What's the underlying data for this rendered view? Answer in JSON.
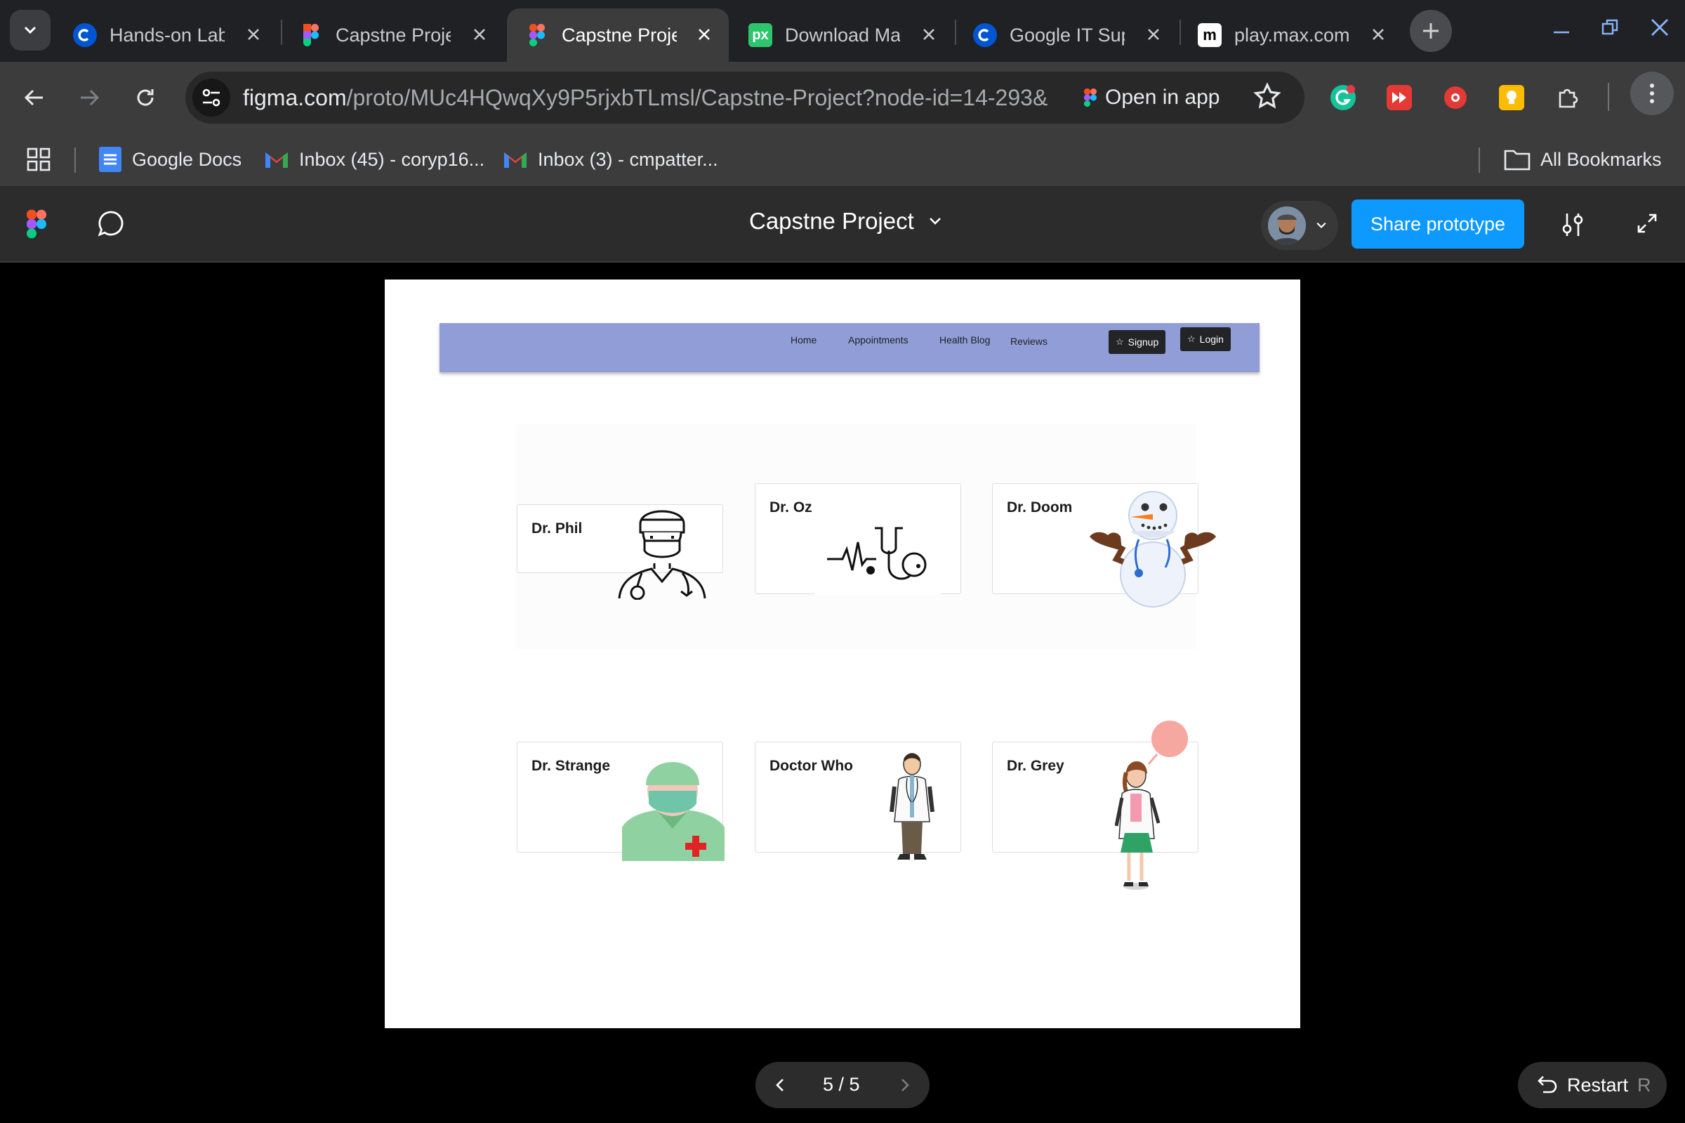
{
  "browser": {
    "tabs": [
      {
        "title": "Hands-on Lab",
        "favicon": "coursera-icon",
        "active": false
      },
      {
        "title": "Capstne Proje",
        "favicon": "figma-icon",
        "active": false
      },
      {
        "title": "Capstne Proje",
        "favicon": "figma-icon",
        "active": true
      },
      {
        "title": "Download Ma",
        "favicon": "pixabay-icon",
        "active": false
      },
      {
        "title": "Google IT Sup",
        "favicon": "coursera-icon",
        "active": false
      },
      {
        "title": "play.max.com",
        "favicon": "max-icon",
        "active": false
      }
    ],
    "address": {
      "host": "figma.com",
      "path": "/proto/MUc4HQwqXy9P5rjxbTLmsl/Capstne-Project?node-id=14-293&p...",
      "open_in_app": "Open in app"
    },
    "bookmarks": [
      {
        "label": "Google Docs",
        "icon": "google-docs-icon"
      },
      {
        "label": "Inbox (45) - coryp16...",
        "icon": "gmail-icon"
      },
      {
        "label": "Inbox (3) - cmpatter...",
        "icon": "gmail-icon"
      }
    ],
    "all_bookmarks": "All Bookmarks"
  },
  "figma": {
    "file_title": "Capstne Project",
    "share_label": "Share prototype",
    "accent": "#0d99ff"
  },
  "prototype": {
    "nav_links": [
      "Home",
      "Appointments",
      "Health Blog",
      "Reviews"
    ],
    "signup_label": "Signup",
    "login_label": "Login",
    "nav_color": "#919dd6",
    "doctors": [
      {
        "name": "Dr. Phil",
        "illustration": "surgeon-line-icon"
      },
      {
        "name": "Dr. Oz",
        "illustration": "heartbeat-stethoscope-icon"
      },
      {
        "name": "Dr. Doom",
        "illustration": "snowman-doctor-icon"
      },
      {
        "name": "Dr. Strange",
        "illustration": "masked-surgeon-icon"
      },
      {
        "name": "Doctor Who",
        "illustration": "cartoon-doctor-icon"
      },
      {
        "name": "Dr. Grey",
        "illustration": "cartoon-female-doctor-icon"
      }
    ]
  },
  "pager": {
    "text": "5 / 5"
  },
  "restart": {
    "label": "Restart",
    "shortcut": "R"
  }
}
